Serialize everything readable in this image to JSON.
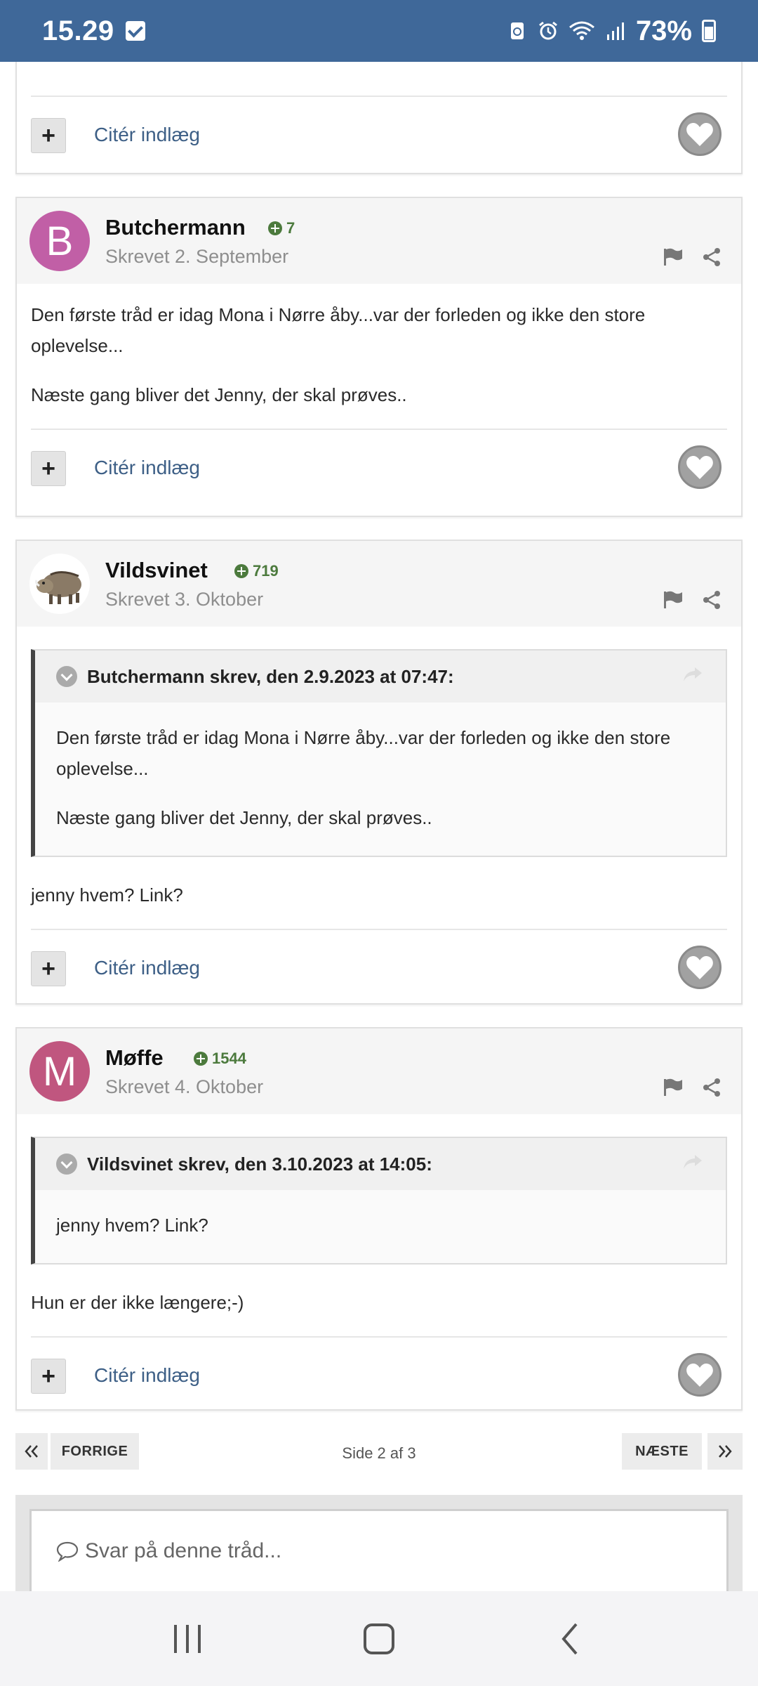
{
  "status": {
    "time": "15.29",
    "battery": "73%"
  },
  "posts": [
    {
      "author": "",
      "rep": "",
      "date": "",
      "quote_label": "Citér indlæg"
    },
    {
      "author": "Butchermann",
      "initial": "B",
      "avatar_color": "#c15fa6",
      "rep": "7",
      "date": "Skrevet 2. September",
      "paras": [
        "Den første tråd er idag Mona i Nørre åby...var der forleden og ikke den store oplevelse...",
        "Næste gang bliver det Jenny, der skal prøves.."
      ],
      "quote_label": "Citér indlæg"
    },
    {
      "author": "Vildsvinet",
      "rep": "719",
      "date": "Skrevet 3. Oktober",
      "quote": {
        "author": "Butchermann skrev, den 2.9.2023 at 07:47:",
        "paras": [
          "Den første tråd er idag Mona i Nørre åby...var der forleden og ikke den store oplevelse...",
          "Næste gang bliver det Jenny, der skal prøves.."
        ]
      },
      "paras": [
        "jenny hvem? Link?"
      ],
      "quote_label": "Citér indlæg"
    },
    {
      "author": "Møffe",
      "initial": "M",
      "avatar_color": "#c0567f",
      "rep": "1544",
      "date": "Skrevet 4. Oktober",
      "quote": {
        "author": "Vildsvinet skrev, den 3.10.2023 at 14:05:",
        "paras": [
          "jenny hvem? Link?"
        ]
      },
      "paras": [
        "Hun er der ikke længere;-)"
      ],
      "quote_label": "Citér indlæg"
    }
  ],
  "pagination": {
    "prev": "FORRIGE",
    "next": "NÆSTE",
    "info": "Side 2 af 3"
  },
  "reply": {
    "placeholder": "Svar på denne tråd..."
  },
  "icons": {
    "flag": "flag-icon",
    "share": "share-icon",
    "heart": "heart-icon",
    "chevron": "chevron-down-icon",
    "arrow": "share-arrow-icon",
    "comment": "comment-icon"
  }
}
